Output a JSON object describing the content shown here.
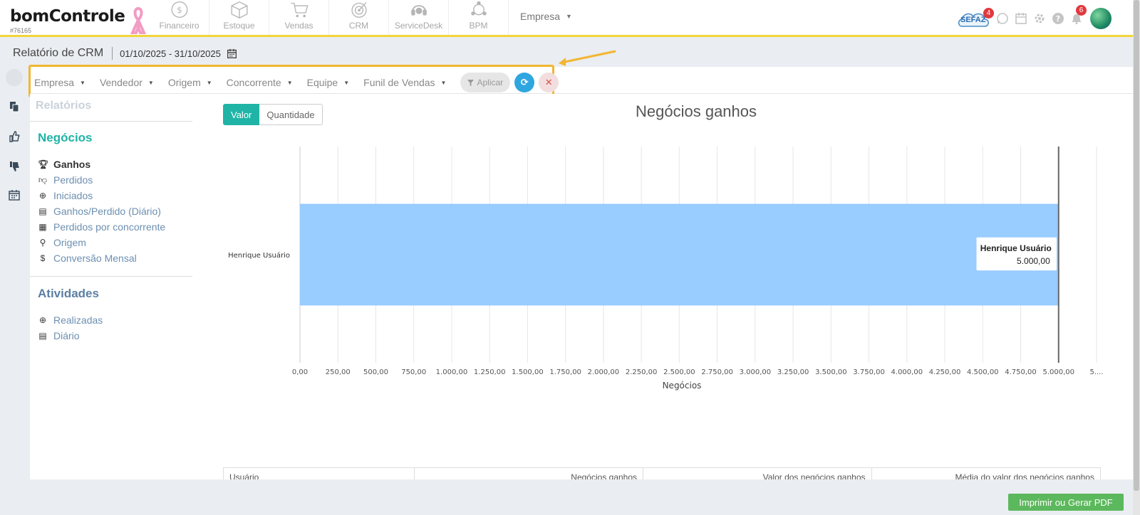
{
  "header": {
    "logo_text": "bomControle",
    "account_id": "#76165",
    "modules": [
      {
        "label": "Financeiro",
        "icon": "dollar-circle-icon"
      },
      {
        "label": "Estoque",
        "icon": "box-icon"
      },
      {
        "label": "Vendas",
        "icon": "cart-icon"
      },
      {
        "label": "CRM",
        "icon": "target-icon"
      },
      {
        "label": "ServiceDesk",
        "icon": "headset-icon"
      },
      {
        "label": "BPM",
        "icon": "network-icon"
      }
    ],
    "company_menu": "Empresa",
    "sefaz_label": "SEFAZ",
    "sefaz_badge": "4",
    "notifications_badge": "6"
  },
  "page": {
    "title": "Relatório de CRM",
    "date_range": "01/10/2025 - 31/10/2025"
  },
  "filters": {
    "items": [
      "Empresa",
      "Vendedor",
      "Origem",
      "Concorrente",
      "Equipe",
      "Funil de Vendas"
    ],
    "apply_label": "Aplicar"
  },
  "sidebar": {
    "reports_title": "Relatórios",
    "negocios_title": "Negócios",
    "negocios_items": [
      {
        "label": "Ganhos",
        "icon": "trophy-icon"
      },
      {
        "label": "Perdidos",
        "icon": "thumbs-down-icon"
      },
      {
        "label": "Iniciados",
        "icon": "plus-circle-icon"
      },
      {
        "label": "Ganhos/Perdido (Diário)",
        "icon": "calendar-icon"
      },
      {
        "label": "Perdidos por concorrente",
        "icon": "building-icon"
      },
      {
        "label": "Origem",
        "icon": "map-marker-icon"
      },
      {
        "label": "Conversão Mensal",
        "icon": "dollar-icon"
      }
    ],
    "atividades_title": "Atividades",
    "atividades_items": [
      {
        "label": "Realizadas",
        "icon": "plus-circle-icon"
      },
      {
        "label": "Diário",
        "icon": "calendar-minus-icon"
      }
    ]
  },
  "toggle": {
    "valor": "Valor",
    "quantidade": "Quantidade"
  },
  "chart_data": {
    "type": "bar",
    "orientation": "horizontal",
    "title": "Negócios ganhos",
    "categories": [
      "Henrique Usuário"
    ],
    "values": [
      5000
    ],
    "xlabel": "Negócios",
    "xlim": [
      0,
      5250
    ],
    "tick_labels": [
      "0,00",
      "250,00",
      "500,00",
      "750,00",
      "1.000,00",
      "1.250,00",
      "1.500,00",
      "1.750,00",
      "2.000,00",
      "2.250,00",
      "2.500,00",
      "2.750,00",
      "3.000,00",
      "3.250,00",
      "3.500,00",
      "3.750,00",
      "4.000,00",
      "4.250,00",
      "4.500,00",
      "4.750,00",
      "5.000,00",
      "5...."
    ],
    "grid": true,
    "bar_color": "#99ccff",
    "tooltip": {
      "name": "Henrique Usuário",
      "value": "5.000,00"
    }
  },
  "table": {
    "headers": [
      "Usuário",
      "Negócios ganhos",
      "Valor dos negócios ganhos",
      "Média do valor dos negócios ganhos"
    ]
  },
  "pdf_button": "Imprimir ou Gerar PDF",
  "colors": {
    "accent_teal": "#1fb4a6",
    "highlight_yellow": "#f2b632",
    "link_blue": "#6c8fb1"
  }
}
